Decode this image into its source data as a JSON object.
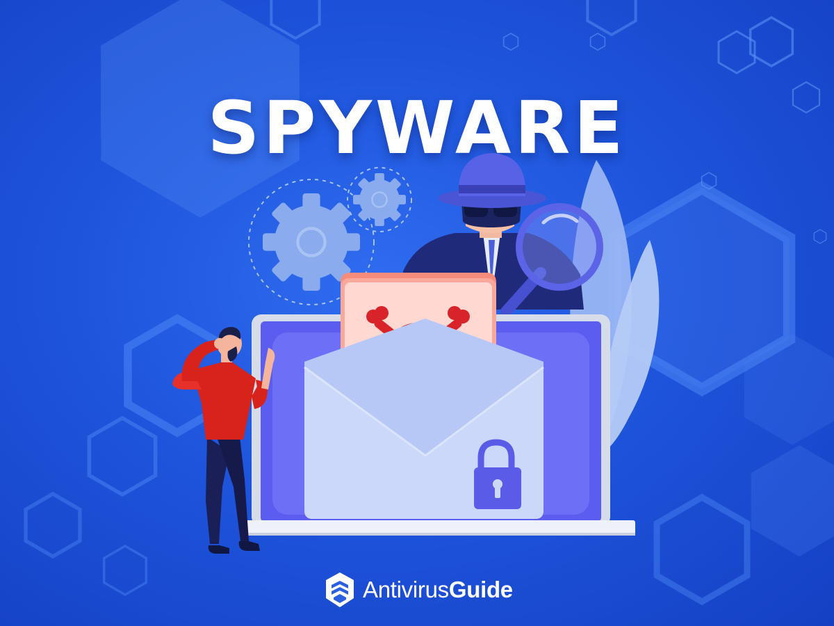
{
  "headline": "SPYWARE",
  "brand": {
    "name_light": "Antivirus",
    "name_bold": "Guide"
  },
  "icons": [
    "shield-logo-icon",
    "gear-icon",
    "spy-agent-icon",
    "magnifier-icon",
    "envelope-icon",
    "skull-crossbones-icon",
    "padlock-icon",
    "laptop-icon",
    "confused-person-icon"
  ],
  "colors": {
    "background": "#1e55dc",
    "title": "#ffffff",
    "warning_letter": "#f9a89c",
    "skull": "#d8232a",
    "person_shirt": "#d8231c",
    "screen": "#5b5cf0",
    "envelope": "#c9d7fa"
  }
}
